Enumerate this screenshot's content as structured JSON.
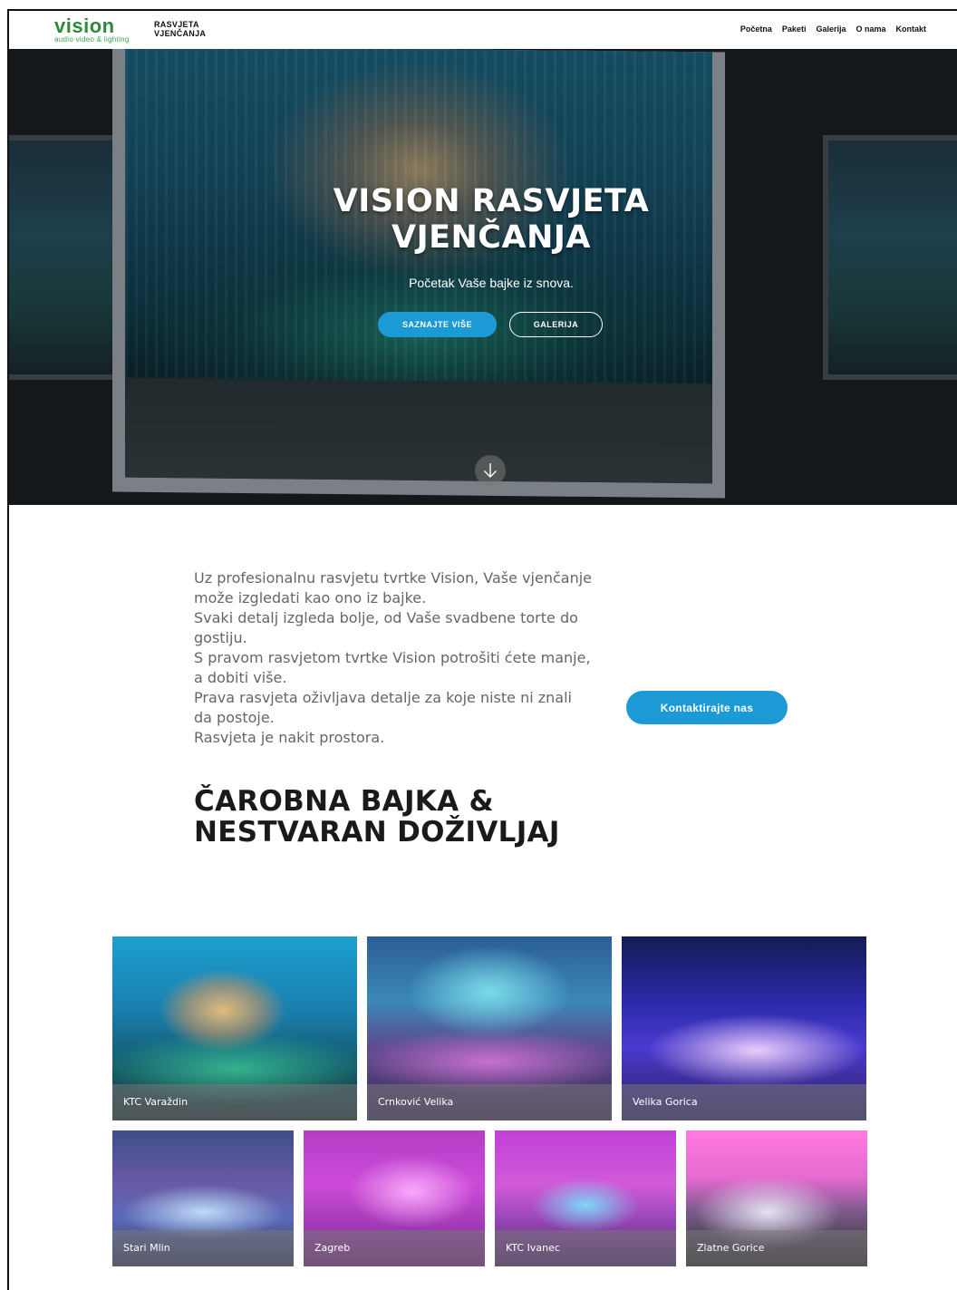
{
  "navbar": {
    "logo_word": "vision",
    "logo_tagline": "audio video & lighting",
    "brand_line1": "RASVJETA",
    "brand_line2": "VJENČANJA",
    "links": [
      "Početna",
      "Paketi",
      "Galerija",
      "O nama",
      "Kontakt"
    ]
  },
  "hero": {
    "title_line1": "VISION RASVJETA",
    "title_line2": "VJENČANJA",
    "subtitle": "Početak Vaše bajke iz snova.",
    "primary_button": "SAZNAJTE VIŠE",
    "secondary_button": "GALERIJA",
    "scroll_icon": "arrow-down-icon"
  },
  "intro": {
    "lines": [
      "Uz profesionalnu rasvjetu tvrtke Vision, Vaše vjenčanje može izgledati kao ono iz bajke.",
      "Svaki detalj izgleda bolje, od Vaše svadbene torte do gostiju.",
      "S pravom rasvjetom tvrtke Vision potrošiti ćete manje, a dobiti više.",
      "Prava rasvjeta oživljava detalje za koje niste ni znali da postoje.",
      "Rasvjeta je nakit prostora."
    ],
    "contact_button": "Kontaktirajte nas"
  },
  "section": {
    "title_line1": "ČAROBNA BAJKA &",
    "title_line2": "NESTVARAN DOŽIVLJAJ"
  },
  "gallery": {
    "items": [
      {
        "label": "KTC Varaždin"
      },
      {
        "label": "Crnković Velika"
      },
      {
        "label": "Velika Gorica"
      },
      {
        "label": "Stari Mlin"
      },
      {
        "label": "Zagreb"
      },
      {
        "label": "KTC Ivanec"
      },
      {
        "label": "Zlatne Gorice"
      }
    ]
  },
  "colors": {
    "accent": "#1b9ad6",
    "logo_green": "#2d8a3a",
    "text_gray": "#666666",
    "heading": "#1a1a1a"
  }
}
